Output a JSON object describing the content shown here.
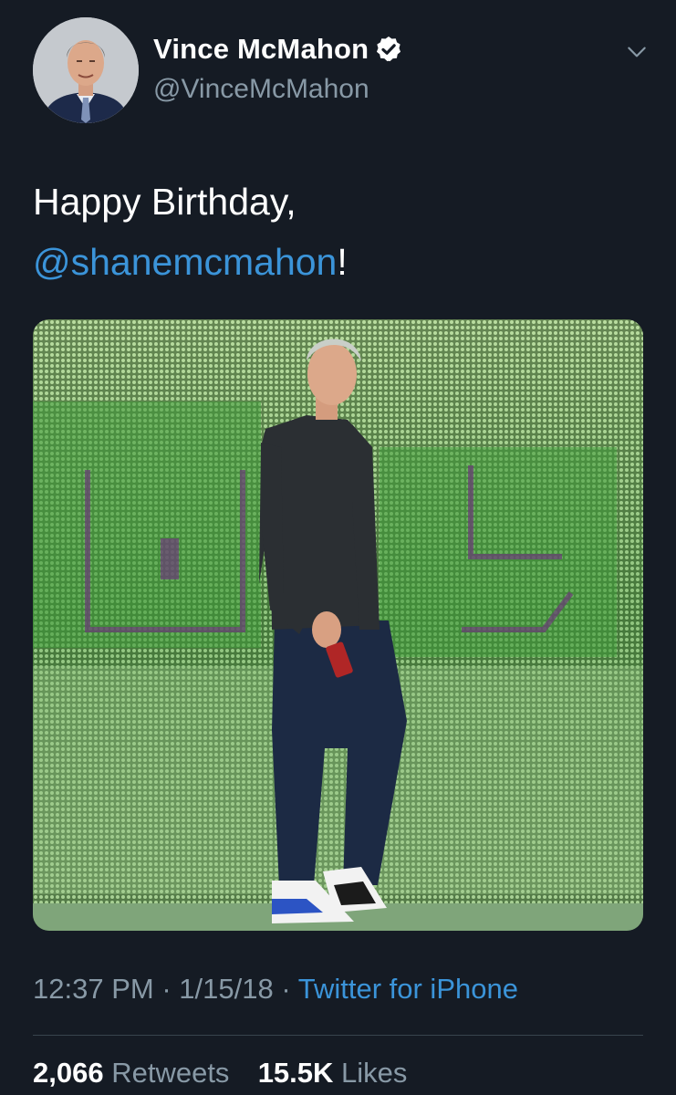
{
  "author": {
    "display_name": "Vince McMahon",
    "handle": "@VinceMcMahon",
    "verified": true
  },
  "tweet": {
    "text_prefix": "Happy Birthday,",
    "mention": "@shanemcmahon",
    "text_suffix": "!"
  },
  "meta": {
    "time": "12:37 PM",
    "separator_1": "·",
    "date": "1/15/18",
    "separator_2": "·",
    "source": "Twitter for iPhone"
  },
  "stats": {
    "retweets_count": "2,066",
    "retweets_label": "Retweets",
    "likes_count": "15.5K",
    "likes_label": "Likes"
  },
  "colors": {
    "background": "#151b24",
    "link": "#3b94d9",
    "secondary_text": "#8899a6",
    "divider": "#38444d"
  },
  "icons": {
    "verified": "verified-badge-icon",
    "caret": "chevron-down-icon"
  }
}
